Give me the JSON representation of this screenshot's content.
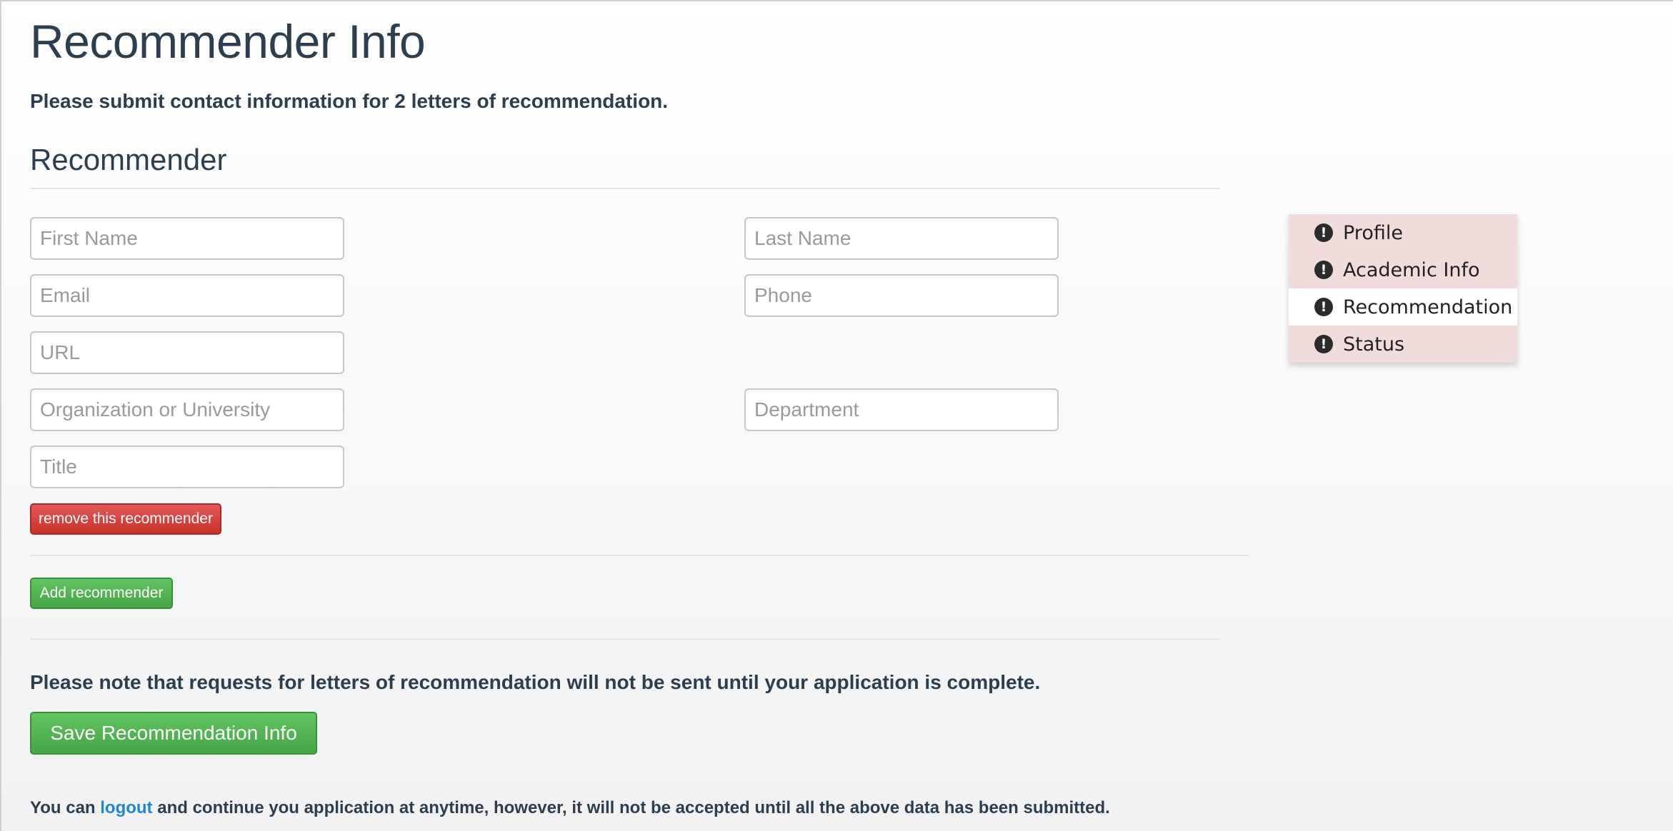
{
  "page": {
    "title": "Recommender Info",
    "intro": "Please submit contact information for 2 letters of recommendation."
  },
  "recommender": {
    "section_title": "Recommender",
    "fields": {
      "first_name": {
        "placeholder": "First Name",
        "value": ""
      },
      "last_name": {
        "placeholder": "Last Name",
        "value": ""
      },
      "email": {
        "placeholder": "Email",
        "value": ""
      },
      "phone": {
        "placeholder": "Phone",
        "value": ""
      },
      "url": {
        "placeholder": "URL",
        "value": ""
      },
      "organization": {
        "placeholder": "Organization or University",
        "value": ""
      },
      "department": {
        "placeholder": "Department",
        "value": ""
      },
      "title": {
        "placeholder": "Title",
        "value": ""
      }
    },
    "remove_label": "remove this recommender"
  },
  "actions": {
    "add_label": "Add recommender",
    "save_label": "Save Recommendation Info"
  },
  "notes": {
    "requests_note": "Please note that requests for letters of recommendation will not be sent until your application is complete.",
    "footer_before": "You can ",
    "footer_link": "logout",
    "footer_after": " and continue you application at anytime, however, it will not be accepted until all the above data has been submitted."
  },
  "side_nav": {
    "icon": "exclamation-circle-icon",
    "items": [
      {
        "label": "Profile",
        "active": false
      },
      {
        "label": "Academic Info",
        "active": false
      },
      {
        "label": "Recommendation",
        "active": true
      },
      {
        "label": "Status",
        "active": false
      }
    ]
  },
  "colors": {
    "text": "#2c3e50",
    "danger": "#c9302c",
    "success": "#46a546",
    "link": "#1f86d1",
    "nav_bg": "#f1dcdc"
  }
}
